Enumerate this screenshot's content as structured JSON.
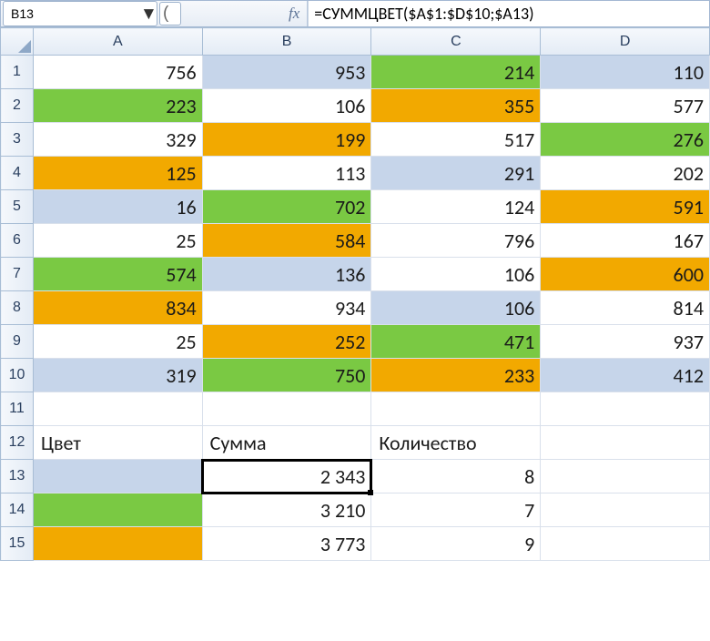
{
  "formulaBar": {
    "nameBox": "B13",
    "fxLabel": "fx",
    "formula": "=СУММЦВЕТ($A$1:$D$10;$A13)",
    "dropdownGlyph": "▼",
    "extraGlyph": "("
  },
  "columns": [
    "A",
    "B",
    "C",
    "D"
  ],
  "rowNumbers": [
    "1",
    "2",
    "3",
    "4",
    "5",
    "6",
    "7",
    "8",
    "9",
    "10",
    "11",
    "12",
    "13",
    "14",
    "15"
  ],
  "activeCell": "B13",
  "colorKey": {
    "W": "bg-white",
    "B": "bg-blue",
    "G": "bg-green",
    "O": "bg-orange"
  },
  "rows": [
    {
      "cells": [
        {
          "v": "756",
          "c": "W"
        },
        {
          "v": "953",
          "c": "B"
        },
        {
          "v": "214",
          "c": "G"
        },
        {
          "v": "110",
          "c": "B"
        }
      ]
    },
    {
      "cells": [
        {
          "v": "223",
          "c": "G"
        },
        {
          "v": "106",
          "c": "W"
        },
        {
          "v": "355",
          "c": "O"
        },
        {
          "v": "577",
          "c": "W"
        }
      ]
    },
    {
      "cells": [
        {
          "v": "329",
          "c": "W"
        },
        {
          "v": "199",
          "c": "O"
        },
        {
          "v": "517",
          "c": "W"
        },
        {
          "v": "276",
          "c": "G"
        }
      ]
    },
    {
      "cells": [
        {
          "v": "125",
          "c": "O"
        },
        {
          "v": "113",
          "c": "W"
        },
        {
          "v": "291",
          "c": "B"
        },
        {
          "v": "202",
          "c": "W"
        }
      ]
    },
    {
      "cells": [
        {
          "v": "16",
          "c": "B"
        },
        {
          "v": "702",
          "c": "G"
        },
        {
          "v": "124",
          "c": "W"
        },
        {
          "v": "591",
          "c": "O"
        }
      ]
    },
    {
      "cells": [
        {
          "v": "25",
          "c": "W"
        },
        {
          "v": "584",
          "c": "O"
        },
        {
          "v": "796",
          "c": "W"
        },
        {
          "v": "167",
          "c": "W"
        }
      ]
    },
    {
      "cells": [
        {
          "v": "574",
          "c": "G"
        },
        {
          "v": "136",
          "c": "B"
        },
        {
          "v": "106",
          "c": "W"
        },
        {
          "v": "600",
          "c": "O"
        }
      ]
    },
    {
      "cells": [
        {
          "v": "834",
          "c": "O"
        },
        {
          "v": "934",
          "c": "W"
        },
        {
          "v": "106",
          "c": "B"
        },
        {
          "v": "814",
          "c": "W"
        }
      ]
    },
    {
      "cells": [
        {
          "v": "25",
          "c": "W"
        },
        {
          "v": "252",
          "c": "O"
        },
        {
          "v": "471",
          "c": "G"
        },
        {
          "v": "937",
          "c": "W"
        }
      ]
    },
    {
      "cells": [
        {
          "v": "319",
          "c": "B"
        },
        {
          "v": "750",
          "c": "G"
        },
        {
          "v": "233",
          "c": "O"
        },
        {
          "v": "412",
          "c": "B"
        }
      ]
    },
    {
      "cells": [
        {
          "v": "",
          "c": "W"
        },
        {
          "v": "",
          "c": "W"
        },
        {
          "v": "",
          "c": "W"
        },
        {
          "v": "",
          "c": "W"
        }
      ]
    },
    {
      "cells": [
        {
          "v": "Цвет",
          "c": "W",
          "a": "left"
        },
        {
          "v": "Сумма",
          "c": "W",
          "a": "left"
        },
        {
          "v": "Количество",
          "c": "W",
          "a": "left"
        },
        {
          "v": "",
          "c": "W"
        }
      ]
    },
    {
      "cells": [
        {
          "v": "",
          "c": "B"
        },
        {
          "v": "2 343",
          "c": "W",
          "active": true
        },
        {
          "v": "8",
          "c": "W"
        },
        {
          "v": "",
          "c": "W"
        }
      ]
    },
    {
      "cells": [
        {
          "v": "",
          "c": "G"
        },
        {
          "v": "3 210",
          "c": "W"
        },
        {
          "v": "7",
          "c": "W"
        },
        {
          "v": "",
          "c": "W"
        }
      ]
    },
    {
      "cells": [
        {
          "v": "",
          "c": "O"
        },
        {
          "v": "3 773",
          "c": "W"
        },
        {
          "v": "9",
          "c": "W"
        },
        {
          "v": "",
          "c": "W"
        }
      ]
    }
  ]
}
